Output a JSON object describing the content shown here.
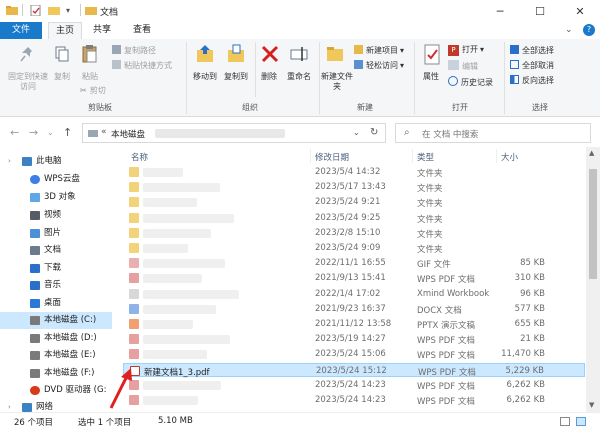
{
  "window": {
    "title": "文档"
  },
  "tabs": [
    "文件",
    "主页",
    "共享",
    "查看"
  ],
  "ribbon": {
    "clipboard": {
      "pin": "固定到快速访问",
      "copy": "复制",
      "paste": "粘贴",
      "copy_path": "复制路径",
      "paste_shortcut": "粘贴快捷方式",
      "cut": "剪切",
      "label": "剪贴板"
    },
    "organize": {
      "move_to": "移动到",
      "copy_to": "复制到",
      "delete": "删除",
      "rename": "重命名",
      "label": "组织"
    },
    "new": {
      "new_folder": "新建文件夹",
      "new_item": "新建项目",
      "easy_access": "轻松访问",
      "label": "新建"
    },
    "open": {
      "properties": "属性",
      "open": "打开",
      "edit": "编辑",
      "history": "历史记录",
      "label": "打开"
    },
    "select": {
      "select_all": "全部选择",
      "select_none": "全部取消",
      "invert": "反向选择",
      "label": "选择"
    }
  },
  "address": {
    "root": "本地磁盘",
    "search_placeholder": "在 文档 中搜索"
  },
  "nav": [
    {
      "label": "此电脑",
      "icon": "pc-icon",
      "indent": 0,
      "color": "#3b82c4"
    },
    {
      "label": "WPS云盘",
      "icon": "cloud-icon",
      "indent": 1,
      "color": "#3d7fe6"
    },
    {
      "label": "3D 对象",
      "icon": "cube-icon",
      "indent": 1,
      "color": "#5fa8e8"
    },
    {
      "label": "视频",
      "icon": "video-icon",
      "indent": 1,
      "color": "#555c66"
    },
    {
      "label": "图片",
      "icon": "picture-icon",
      "indent": 1,
      "color": "#4a90d9"
    },
    {
      "label": "文档",
      "icon": "document-icon",
      "indent": 1,
      "color": "#6b7a8c"
    },
    {
      "label": "下载",
      "icon": "download-icon",
      "indent": 1,
      "color": "#2a6fc9"
    },
    {
      "label": "音乐",
      "icon": "music-icon",
      "indent": 1,
      "color": "#2a6fc9"
    },
    {
      "label": "桌面",
      "icon": "desktop-icon",
      "indent": 1,
      "color": "#2b79d6"
    },
    {
      "label": "本地磁盘 (C:)",
      "icon": "drive-icon",
      "indent": 1,
      "color": "#7a7a7a",
      "selected": true
    },
    {
      "label": "本地磁盘 (D:)",
      "icon": "drive-icon",
      "indent": 1,
      "color": "#7a7a7a"
    },
    {
      "label": "本地磁盘 (E:)",
      "icon": "drive-icon",
      "indent": 1,
      "color": "#7a7a7a"
    },
    {
      "label": "本地磁盘 (F:)",
      "icon": "drive-icon",
      "indent": 1,
      "color": "#7a7a7a"
    },
    {
      "label": "DVD 驱动器 (G:",
      "icon": "dvd-icon",
      "indent": 1,
      "color": "#d83b1a"
    },
    {
      "label": "网络",
      "icon": "network-icon",
      "indent": 0,
      "color": "#3b82c4"
    }
  ],
  "columns": {
    "name": "名称",
    "date": "修改日期",
    "type": "类型",
    "size": "大小"
  },
  "files": [
    {
      "name": "",
      "date": "2023/5/4 14:32",
      "type": "文件夹",
      "size": "",
      "kind": "folder"
    },
    {
      "name": "",
      "date": "2023/5/17 13:43",
      "type": "文件夹",
      "size": "",
      "kind": "folder"
    },
    {
      "name": "",
      "date": "2023/5/24 9:21",
      "type": "文件夹",
      "size": "",
      "kind": "folder"
    },
    {
      "name": "",
      "date": "2023/5/24 9:25",
      "type": "文件夹",
      "size": "",
      "kind": "folder"
    },
    {
      "name": "",
      "date": "2023/2/8 15:10",
      "type": "文件夹",
      "size": "",
      "kind": "folder"
    },
    {
      "name": "",
      "date": "2023/5/24 9:09",
      "type": "文件夹",
      "size": "",
      "kind": "folder"
    },
    {
      "name": "",
      "date": "2022/11/1 16:55",
      "type": "GIF 文件",
      "size": "85 KB",
      "kind": "gif"
    },
    {
      "name": "",
      "date": "2021/9/13 15:41",
      "type": "WPS PDF 文档",
      "size": "310 KB",
      "kind": "pdf"
    },
    {
      "name": "",
      "date": "2022/1/4 17:02",
      "type": "Xmind Workbook",
      "size": "96 KB",
      "kind": "xmind"
    },
    {
      "name": "",
      "date": "2021/9/23 16:37",
      "type": "DOCX 文档",
      "size": "577 KB",
      "kind": "docx"
    },
    {
      "name": "",
      "date": "2021/11/12 13:58",
      "type": "PPTX 演示文稿",
      "size": "655 KB",
      "kind": "pptx"
    },
    {
      "name": "",
      "date": "2023/5/19 14:27",
      "type": "WPS PDF 文档",
      "size": "21 KB",
      "kind": "pdf"
    },
    {
      "name": "",
      "date": "2023/5/24 15:06",
      "type": "WPS PDF 文档",
      "size": "11,470 KB",
      "kind": "pdf"
    },
    {
      "name": "新建文档1_3.pdf",
      "date": "2023/5/24 15:12",
      "type": "WPS PDF 文档",
      "size": "5,229 KB",
      "kind": "pdf",
      "selected": true
    },
    {
      "name": "",
      "date": "2023/5/24 14:23",
      "type": "WPS PDF 文档",
      "size": "6,262 KB",
      "kind": "pdf"
    },
    {
      "name": "",
      "date": "2023/5/24 14:23",
      "type": "WPS PDF 文档",
      "size": "6,262 KB",
      "kind": "pdf"
    }
  ],
  "status": {
    "count": "26 个项目",
    "selected": "选中 1 个项目",
    "size": "5.10 MB"
  },
  "colors": {
    "accent": "#1979ca",
    "selection": "#cce8ff",
    "annotation_arrow": "#e02020"
  }
}
